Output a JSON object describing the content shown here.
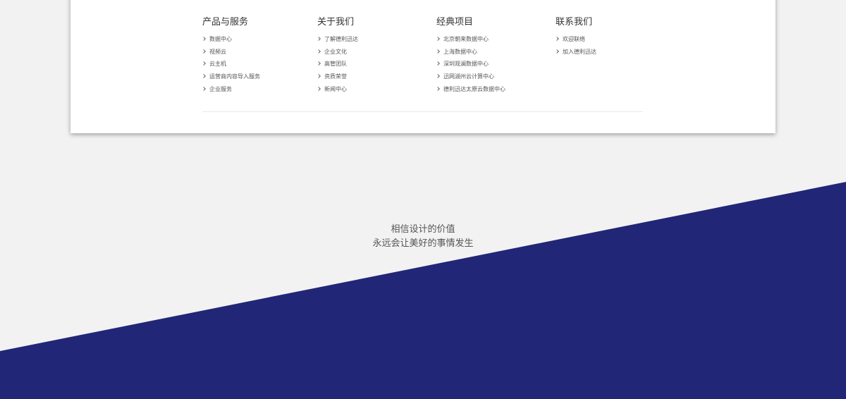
{
  "footer_nav": [
    {
      "title": "产品与服务",
      "items": [
        "数据中心",
        "视频云",
        "云主机",
        "运营商内容导入服务",
        "企业服务"
      ]
    },
    {
      "title": "关于我们",
      "items": [
        "了解德利迅达",
        "企业文化",
        "高管团队",
        "资质荣誉",
        "新闻中心"
      ]
    },
    {
      "title": "经典项目",
      "items": [
        "北京朝来数据中心",
        "上海数据中心",
        "深圳观澜数据中心",
        "迅网湖州云计算中心",
        "德利迅达太原云数据中心"
      ]
    },
    {
      "title": "联系我们",
      "items": [
        "欢迎联络",
        "加入德利迅达"
      ]
    }
  ],
  "slogan": {
    "line1": "相信设计的价值",
    "line2": "永远会让美好的事情发生"
  },
  "colors": {
    "background": "#f2f2f2",
    "diagonal_band": "#212677",
    "card": "#ffffff"
  }
}
